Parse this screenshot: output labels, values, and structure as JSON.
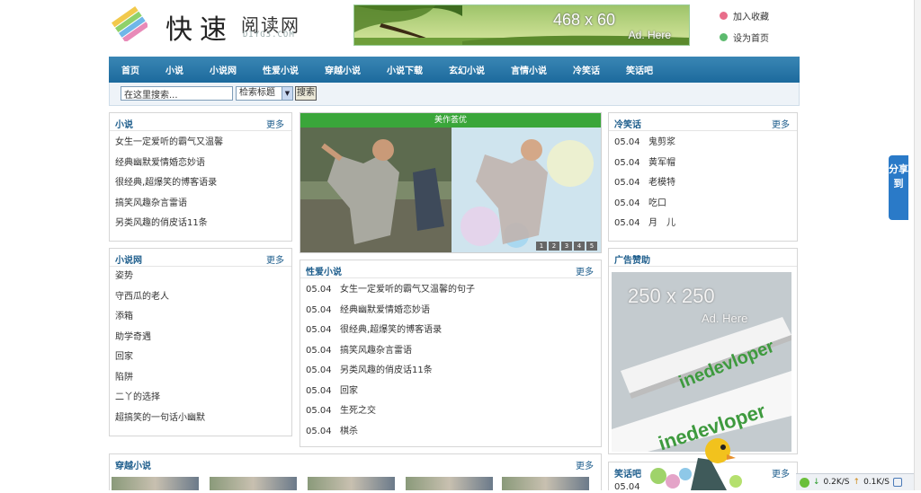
{
  "header": {
    "logo_cn_main": "快速",
    "logo_cn_sub": "阅读网",
    "logo_domain": "DIYG3.COM",
    "top_ad": {
      "size_text": "468 x 60",
      "here_text": "Ad. Here"
    },
    "links": [
      {
        "label": "加入收藏",
        "color": "#e86d8a",
        "icon": "heart-icon"
      },
      {
        "label": "设为首页",
        "color": "#5cba6e",
        "icon": "home-dot-icon"
      }
    ]
  },
  "nav": {
    "items": [
      "首页",
      "小说",
      "小说网",
      "性爱小说",
      "穿越小说",
      "小说下载",
      "玄幻小说",
      "言情小说",
      "冷笑话",
      "笑话吧"
    ]
  },
  "search": {
    "input_value": "在这里搜索...",
    "select_value": "检索标题",
    "button_label": "搜索"
  },
  "more_label": "更多",
  "boxes": {
    "novel": {
      "title": "小说",
      "items": [
        "女生一定爱听的霸气又温馨",
        "经典幽默爱情婚恋妙语",
        "很经典,超爆笑的博客语录",
        "搞笑风趣杂言雷语",
        "另类风趣的俏皮话11条"
      ]
    },
    "novel_site": {
      "title": "小说网",
      "items": [
        "姿势",
        "守西瓜的老人",
        "添箱",
        "助学奇遇",
        "回家",
        "陷阱",
        "二丫的选择",
        "超搞笑的一句话小幽默"
      ]
    },
    "slideshow": {
      "header": "美作荟优",
      "pages": [
        "1",
        "2",
        "3",
        "4",
        "5"
      ]
    },
    "sexy_novel": {
      "title": "性爱小说",
      "items": [
        {
          "date": "05.04",
          "text": "女生一定爱听的霸气又温馨的句子"
        },
        {
          "date": "05.04",
          "text": "经典幽默爱情婚恋妙语"
        },
        {
          "date": "05.04",
          "text": "很经典,超爆笑的博客语录"
        },
        {
          "date": "05.04",
          "text": "搞笑风趣杂言雷语"
        },
        {
          "date": "05.04",
          "text": "另类风趣的俏皮话11条"
        },
        {
          "date": "05.04",
          "text": "回家"
        },
        {
          "date": "05.04",
          "text": "生死之交"
        },
        {
          "date": "05.04",
          "text": "棋杀"
        }
      ]
    },
    "cold_joke": {
      "title": "冷笑话",
      "items": [
        {
          "date": "05.04",
          "text": "鬼剪浆"
        },
        {
          "date": "05.04",
          "text": "黄军帽"
        },
        {
          "date": "05.04",
          "text": "老模特"
        },
        {
          "date": "05.04",
          "text": "吃口"
        },
        {
          "date": "05.04",
          "text": "月　儿"
        }
      ]
    },
    "ad_box": {
      "title": "广告赞助",
      "size_text": "250 x 250",
      "here_text": "Ad. Here",
      "brand": "inedevloper"
    },
    "time_travel": {
      "title": "穿越小说"
    },
    "joke_bar": {
      "title": "笑话吧",
      "first_date": "05.04"
    }
  },
  "share": {
    "label": "分享到"
  },
  "statusbar": {
    "down": "0.2K/S",
    "up": "0.1K/S"
  }
}
